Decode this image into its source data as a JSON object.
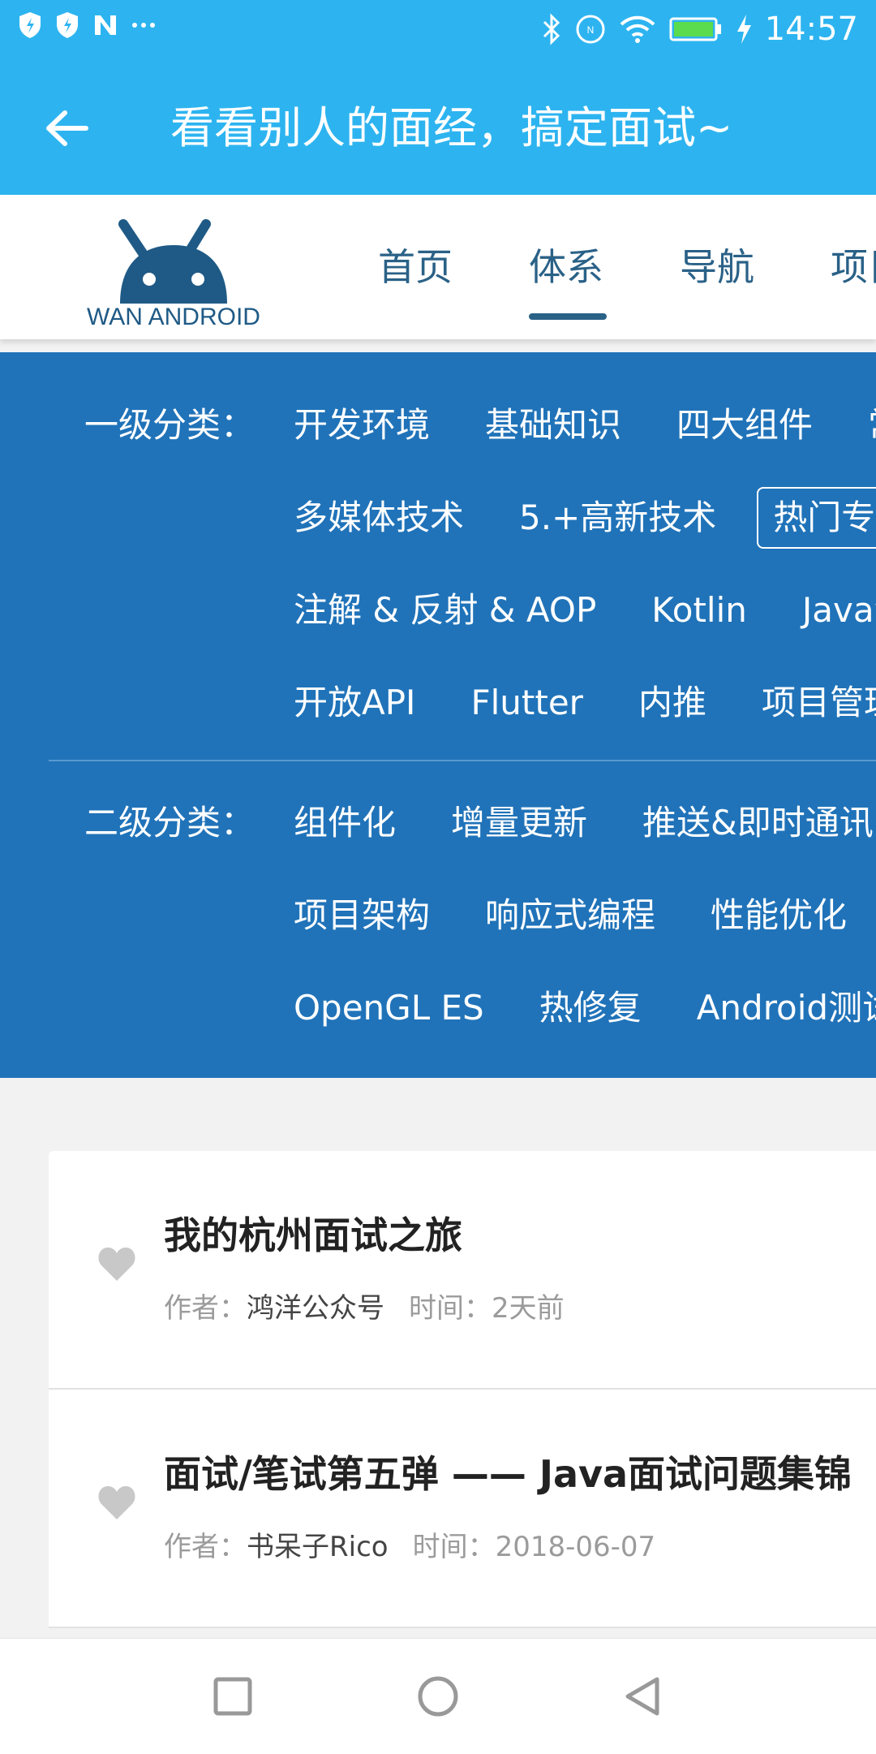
{
  "status_bar": {
    "time": "14:57",
    "left_icons": [
      "shield-icon",
      "shield-icon",
      "n-icon",
      "more-dots-icon"
    ],
    "right_icons": [
      "bluetooth-icon",
      "nfc-icon",
      "wifi-icon",
      "battery-icon",
      "charging-icon"
    ]
  },
  "app_bar": {
    "title": "看看别人的面经，搞定面试~",
    "back_icon": "arrow-left-icon"
  },
  "site": {
    "logo_text": "WAN ANDROID",
    "nav": [
      {
        "label": "首页"
      },
      {
        "label": "体系",
        "active": true
      },
      {
        "label": "导航"
      },
      {
        "label": "项目"
      }
    ]
  },
  "categories": {
    "level1_label": "一级分类：",
    "level1_rows": [
      [
        "开发环境",
        "基础知识",
        "四大组件",
        "常用控件"
      ],
      [
        "多媒体技术",
        "5.+高新技术",
        "热门专题"
      ],
      [
        "注解 & 反射 & AOP",
        "Kotlin",
        "Java深入"
      ],
      [
        "开放API",
        "Flutter",
        "内推",
        "项目管理"
      ]
    ],
    "level1_selected": "热门专题",
    "level2_label": "二级分类：",
    "level2_rows": [
      [
        "组件化",
        "增量更新",
        "推送&即时通讯"
      ],
      [
        "项目架构",
        "响应式编程",
        "性能优化"
      ],
      [
        "OpenGL ES",
        "热修复",
        "Android测试相关"
      ]
    ]
  },
  "articles": [
    {
      "title": "我的杭州面试之旅",
      "author_label": "作者：",
      "author": "鸿洋公众号",
      "time_label": "时间：",
      "time": "2天前"
    },
    {
      "title": "面试/笔试第五弹 —— Java面试问题集锦（",
      "author_label": "作者：",
      "author": "书呆子Rico",
      "time_label": "时间：",
      "time": "2018-06-07"
    }
  ],
  "colors": {
    "app_bar": "#2db4f0",
    "category_panel": "#2073b9",
    "nav_text": "#2a6187"
  }
}
